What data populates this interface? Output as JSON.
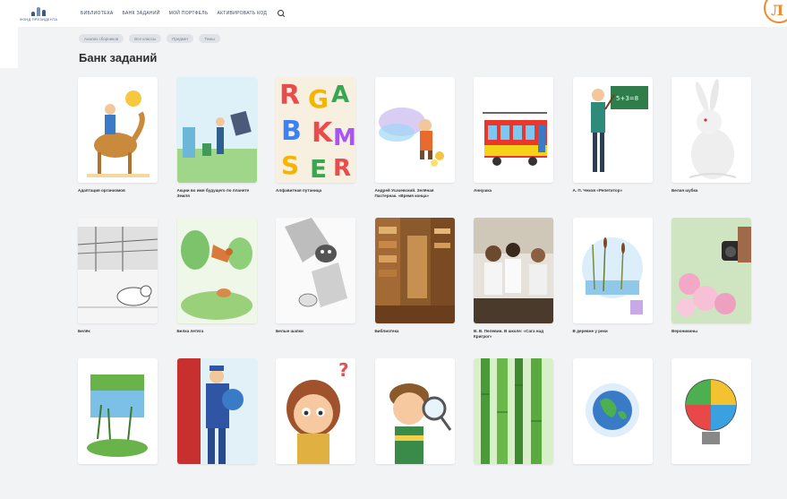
{
  "header": {
    "logo_text": "ФОНД ПРЕЗИДЕНТА",
    "nav": [
      {
        "label": "Библиотека"
      },
      {
        "label": "Банк заданий"
      },
      {
        "label": "Мой портфель"
      },
      {
        "label": "Активировать код"
      }
    ],
    "search_icon": "search-icon",
    "corner_logo_letter": "Л",
    "accent_color": "#f08a2c"
  },
  "filters": [
    "Анализ сборников",
    "Все классы",
    "Предмет",
    "Темы"
  ],
  "page_title": "Банк заданий",
  "cards": [
    {
      "title": "Адаптация организмов",
      "illustration": "camel"
    },
    {
      "title": "Акции во имя будущего по планете Земля",
      "illustration": "recycling"
    },
    {
      "title": "Алфавитная путаница",
      "illustration": "letters"
    },
    {
      "title": "Андрей Усачевский. Зелёная Пастернак. «Время конца»",
      "illustration": "boy-painting"
    },
    {
      "title": "Аннушка",
      "illustration": "tram"
    },
    {
      "title": "А. П. Чехов «Репетитор»",
      "illustration": "teacher"
    },
    {
      "title": "Белая шубка",
      "illustration": "white-hare"
    },
    {
      "title": "Белёк",
      "illustration": "seal-sketch"
    },
    {
      "title": "Белка летяга",
      "illustration": "flying-squirrel"
    },
    {
      "title": "Белые шапки",
      "illustration": "owl-sketch"
    },
    {
      "title": "Библиотека",
      "illustration": "library"
    },
    {
      "title": "В. В. Пелевин. В школе: «Сага над Кригрог»",
      "illustration": "students"
    },
    {
      "title": "В деревне у реки",
      "illustration": "river-reeds"
    },
    {
      "title": "Вероникины",
      "illustration": "flowers-camera"
    },
    {
      "title": "",
      "illustration": "pond"
    },
    {
      "title": "",
      "illustration": "firefighter"
    },
    {
      "title": "",
      "illustration": "girl-question"
    },
    {
      "title": "",
      "illustration": "boy-magnifier"
    },
    {
      "title": "",
      "illustration": "bamboo"
    },
    {
      "title": "",
      "illustration": "globe"
    },
    {
      "title": "",
      "illustration": "puzzle-bulb"
    }
  ]
}
